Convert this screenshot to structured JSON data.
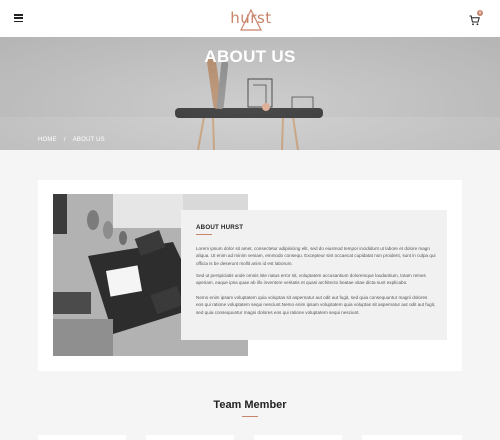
{
  "header": {
    "logo_text": "hurst",
    "cart_count": "0",
    "icons": {
      "menu": "hamburger-menu-icon",
      "cart": "shopping-cart-icon"
    }
  },
  "hero": {
    "title": "ABOUT US",
    "breadcrumb": {
      "home": "HOME",
      "separator": "/",
      "current": "ABOUT US"
    }
  },
  "about": {
    "heading": "ABOUT HURST",
    "paragraphs": [
      "Lorem ipsum dolor sit amet, consectetur adipisicing elit, sed do eiusmod tempor incididunt ut labore et dolore magn aliqua. Ut enim ad minim veniam, emmodo consequ. Excepteur sint occaecat cupidatat non proident, sunt in culpa qui officia is be deserunt mollit anim id est laborum.",
      "Sed ut perspiciatis unde omnis iste natus error sit, voluptatem accusantium doloremque laudantium, totam remes aperiam, eaque ipsa quae ab illo inventore veritatis et quasi architecto beatae vitae dicta sunt explicabo.",
      "Nemo enim ipsam voluptatem quia voluptas sit aspernatur aut odit aut fugit, sed quia consequuntur magni dolores eos qui ratione voluptatem sequi nesciunt.Nemo enim ipsam voluptatem quia voluptas sit aspernatur aut odit aut fugit, sed quia consequuntur magni dolores eos qui ratione voluptatem sequi nesciunt."
    ]
  },
  "team": {
    "title": "Team Member"
  },
  "colors": {
    "accent": "#c9856b",
    "page_bg": "#f5f5f5",
    "card_bg": "#ffffff",
    "text_box_bg": "#f1f1f1"
  }
}
